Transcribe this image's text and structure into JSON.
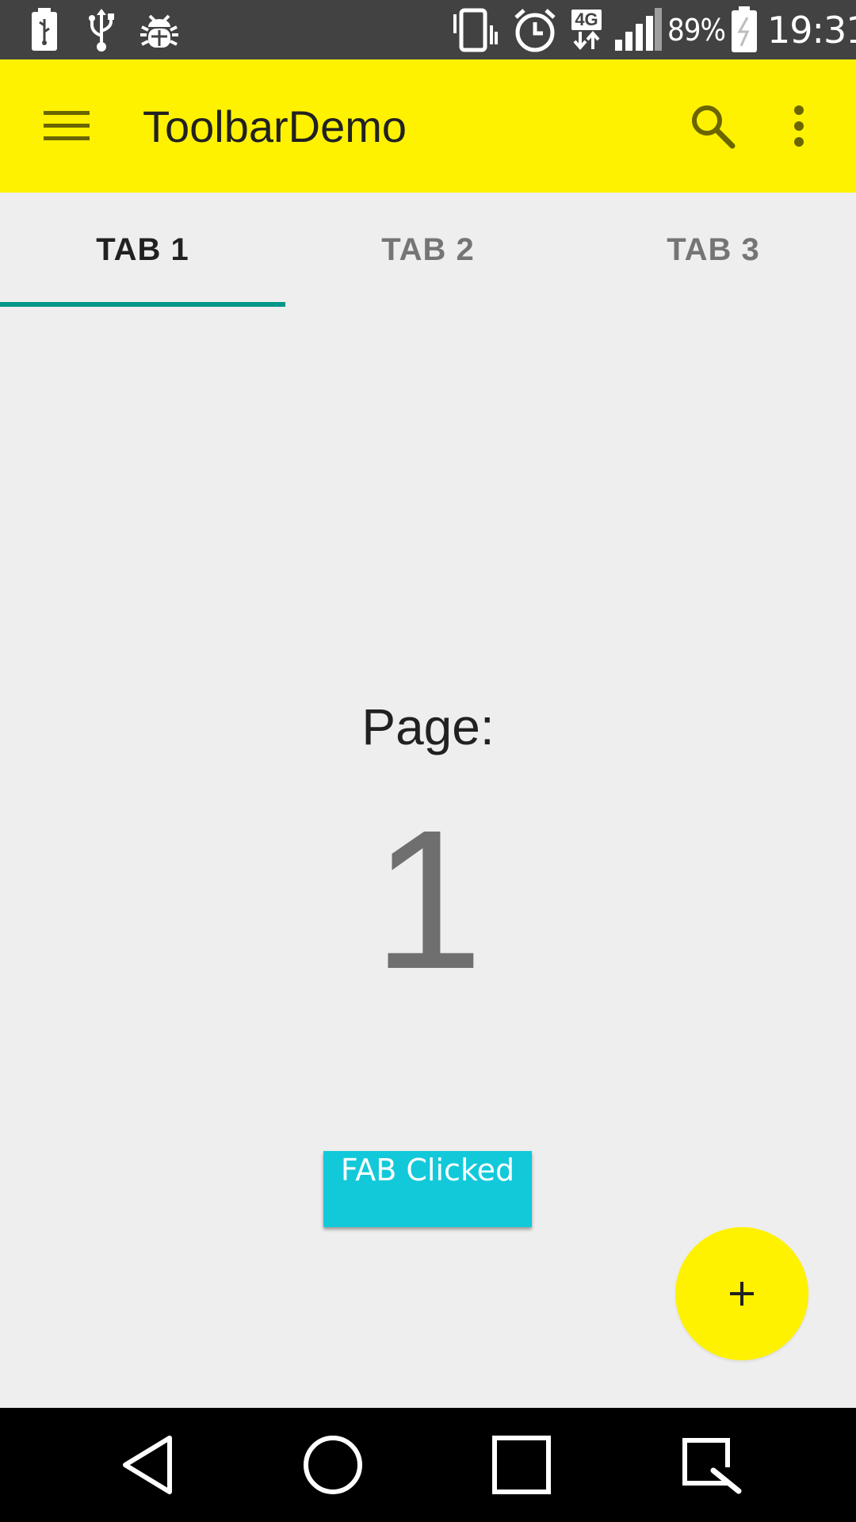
{
  "status_bar": {
    "icons": [
      "battery-charging-icon",
      "usb-icon",
      "debug-bug-icon",
      "vibrate-icon",
      "alarm-icon",
      "network-4g-icon",
      "signal-icon",
      "battery-icon"
    ],
    "network_label": "4G",
    "battery_percent": "89%",
    "time": "19:31"
  },
  "toolbar": {
    "title": "ToolbarDemo",
    "background": "#fff200",
    "icons": [
      "menu-icon",
      "search-icon",
      "overflow-menu-icon"
    ]
  },
  "tabs": {
    "items": [
      {
        "label": "TAB 1",
        "active": true
      },
      {
        "label": "TAB 2",
        "active": false
      },
      {
        "label": "TAB 3",
        "active": false
      }
    ],
    "indicator_color": "#009688"
  },
  "content": {
    "page_label": "Page:",
    "page_number": "1"
  },
  "toast": {
    "message": "FAB Clicked",
    "background": "#12c9da"
  },
  "fab": {
    "icon": "plus-icon",
    "background": "#fff200"
  },
  "nav_bar": {
    "icons": [
      "back-icon",
      "home-icon",
      "recents-icon",
      "screen-capture-icon"
    ]
  }
}
